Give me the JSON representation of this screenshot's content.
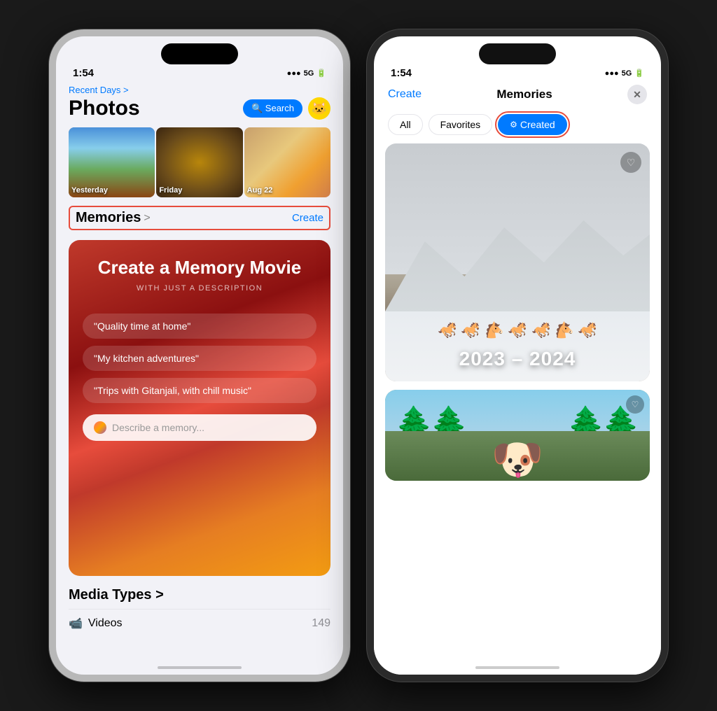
{
  "left_phone": {
    "status": {
      "time": "1:54",
      "location_icon": "▶",
      "signal": "●●●",
      "network": "5G",
      "battery": "▮▮▮"
    },
    "header": {
      "recent_days": "Recent Days >",
      "title": "Photos",
      "search_label": "🔍 Search",
      "avatar_emoji": "🐱"
    },
    "thumbnails": [
      {
        "label": "Yesterday",
        "style": "city"
      },
      {
        "label": "Friday",
        "style": "food"
      },
      {
        "label": "Aug 22",
        "style": "meal"
      }
    ],
    "memories": {
      "section_title": "Memories",
      "chevron": ">",
      "create_link": "Create",
      "card": {
        "title": "Create a Memory Movie",
        "subtitle": "WITH JUST A DESCRIPTION",
        "suggestions": [
          "\"Quality time at home\"",
          "\"My kitchen adventures\"",
          "\"Trips with Gitanjali, with chill music\""
        ],
        "placeholder": "Describe a memory..."
      }
    },
    "media_types": {
      "title": "Media Types >",
      "items": [
        {
          "icon": "🎬",
          "label": "Videos",
          "count": "149"
        }
      ]
    }
  },
  "right_phone": {
    "status": {
      "time": "1:54",
      "location_icon": "▶",
      "signal": "●●●",
      "network": "5G",
      "battery": "▮▮▮"
    },
    "nav": {
      "create": "Create",
      "title": "Memories",
      "close": "✕"
    },
    "filters": {
      "tabs": [
        "All",
        "Favorites",
        "Created"
      ],
      "active": "Created",
      "active_icon": "⚙"
    },
    "memories": [
      {
        "year_label": "2023 – 2024",
        "type": "horses"
      },
      {
        "type": "dog"
      }
    ]
  }
}
